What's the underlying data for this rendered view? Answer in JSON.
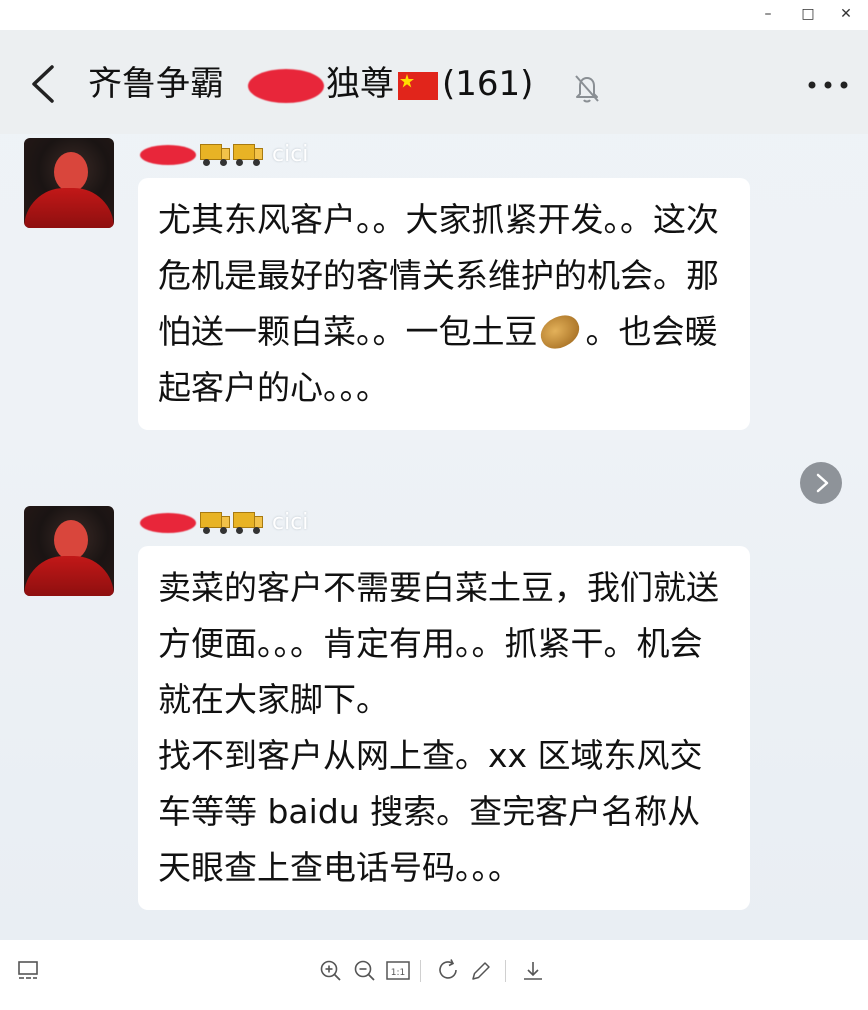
{
  "window": {
    "minimize_label": "–",
    "maximize_label": "□",
    "close_label": "✕"
  },
  "chat": {
    "title_prefix": "齐鲁争霸",
    "title_suffix": "独尊",
    "member_count": "(161)",
    "icons": {
      "back": "chevron-left-icon",
      "mute": "bell-muted-icon",
      "more": "more-dots-icon",
      "next": "chevron-right-icon"
    },
    "colors": {
      "background": "#eef2f6",
      "header": "#eceff1",
      "bubble": "#ffffff",
      "redaction": "#e8263a",
      "next_button": "#8e9399"
    }
  },
  "messages": [
    {
      "sender_name": "cici",
      "text_before_emoji": "尤其东风客户。。大家抓紧开发。。这次危机是最好的客情关系维护的机会。那怕送一颗白菜。。一包土豆",
      "emoji": "potato-emoji",
      "text_after_emoji": "。也会暖起客户的心。。。"
    },
    {
      "sender_name": "cici",
      "text": "卖菜的客户不需要白菜土豆，我们就送方便面。。。肯定有用。。抓紧干。机会就在大家脚下。\n找不到客户从网上查。xx 区域东风交车等等 baidu 搜索。查完客户名称从天眼查上查电话号码。。。"
    }
  ],
  "toolbar": {
    "items": [
      "thumbnail-icon",
      "zoom-in-icon",
      "zoom-out-icon",
      "actual-size-icon",
      "rotate-icon",
      "edit-icon",
      "download-icon"
    ],
    "actual_size_label": "1:1"
  }
}
